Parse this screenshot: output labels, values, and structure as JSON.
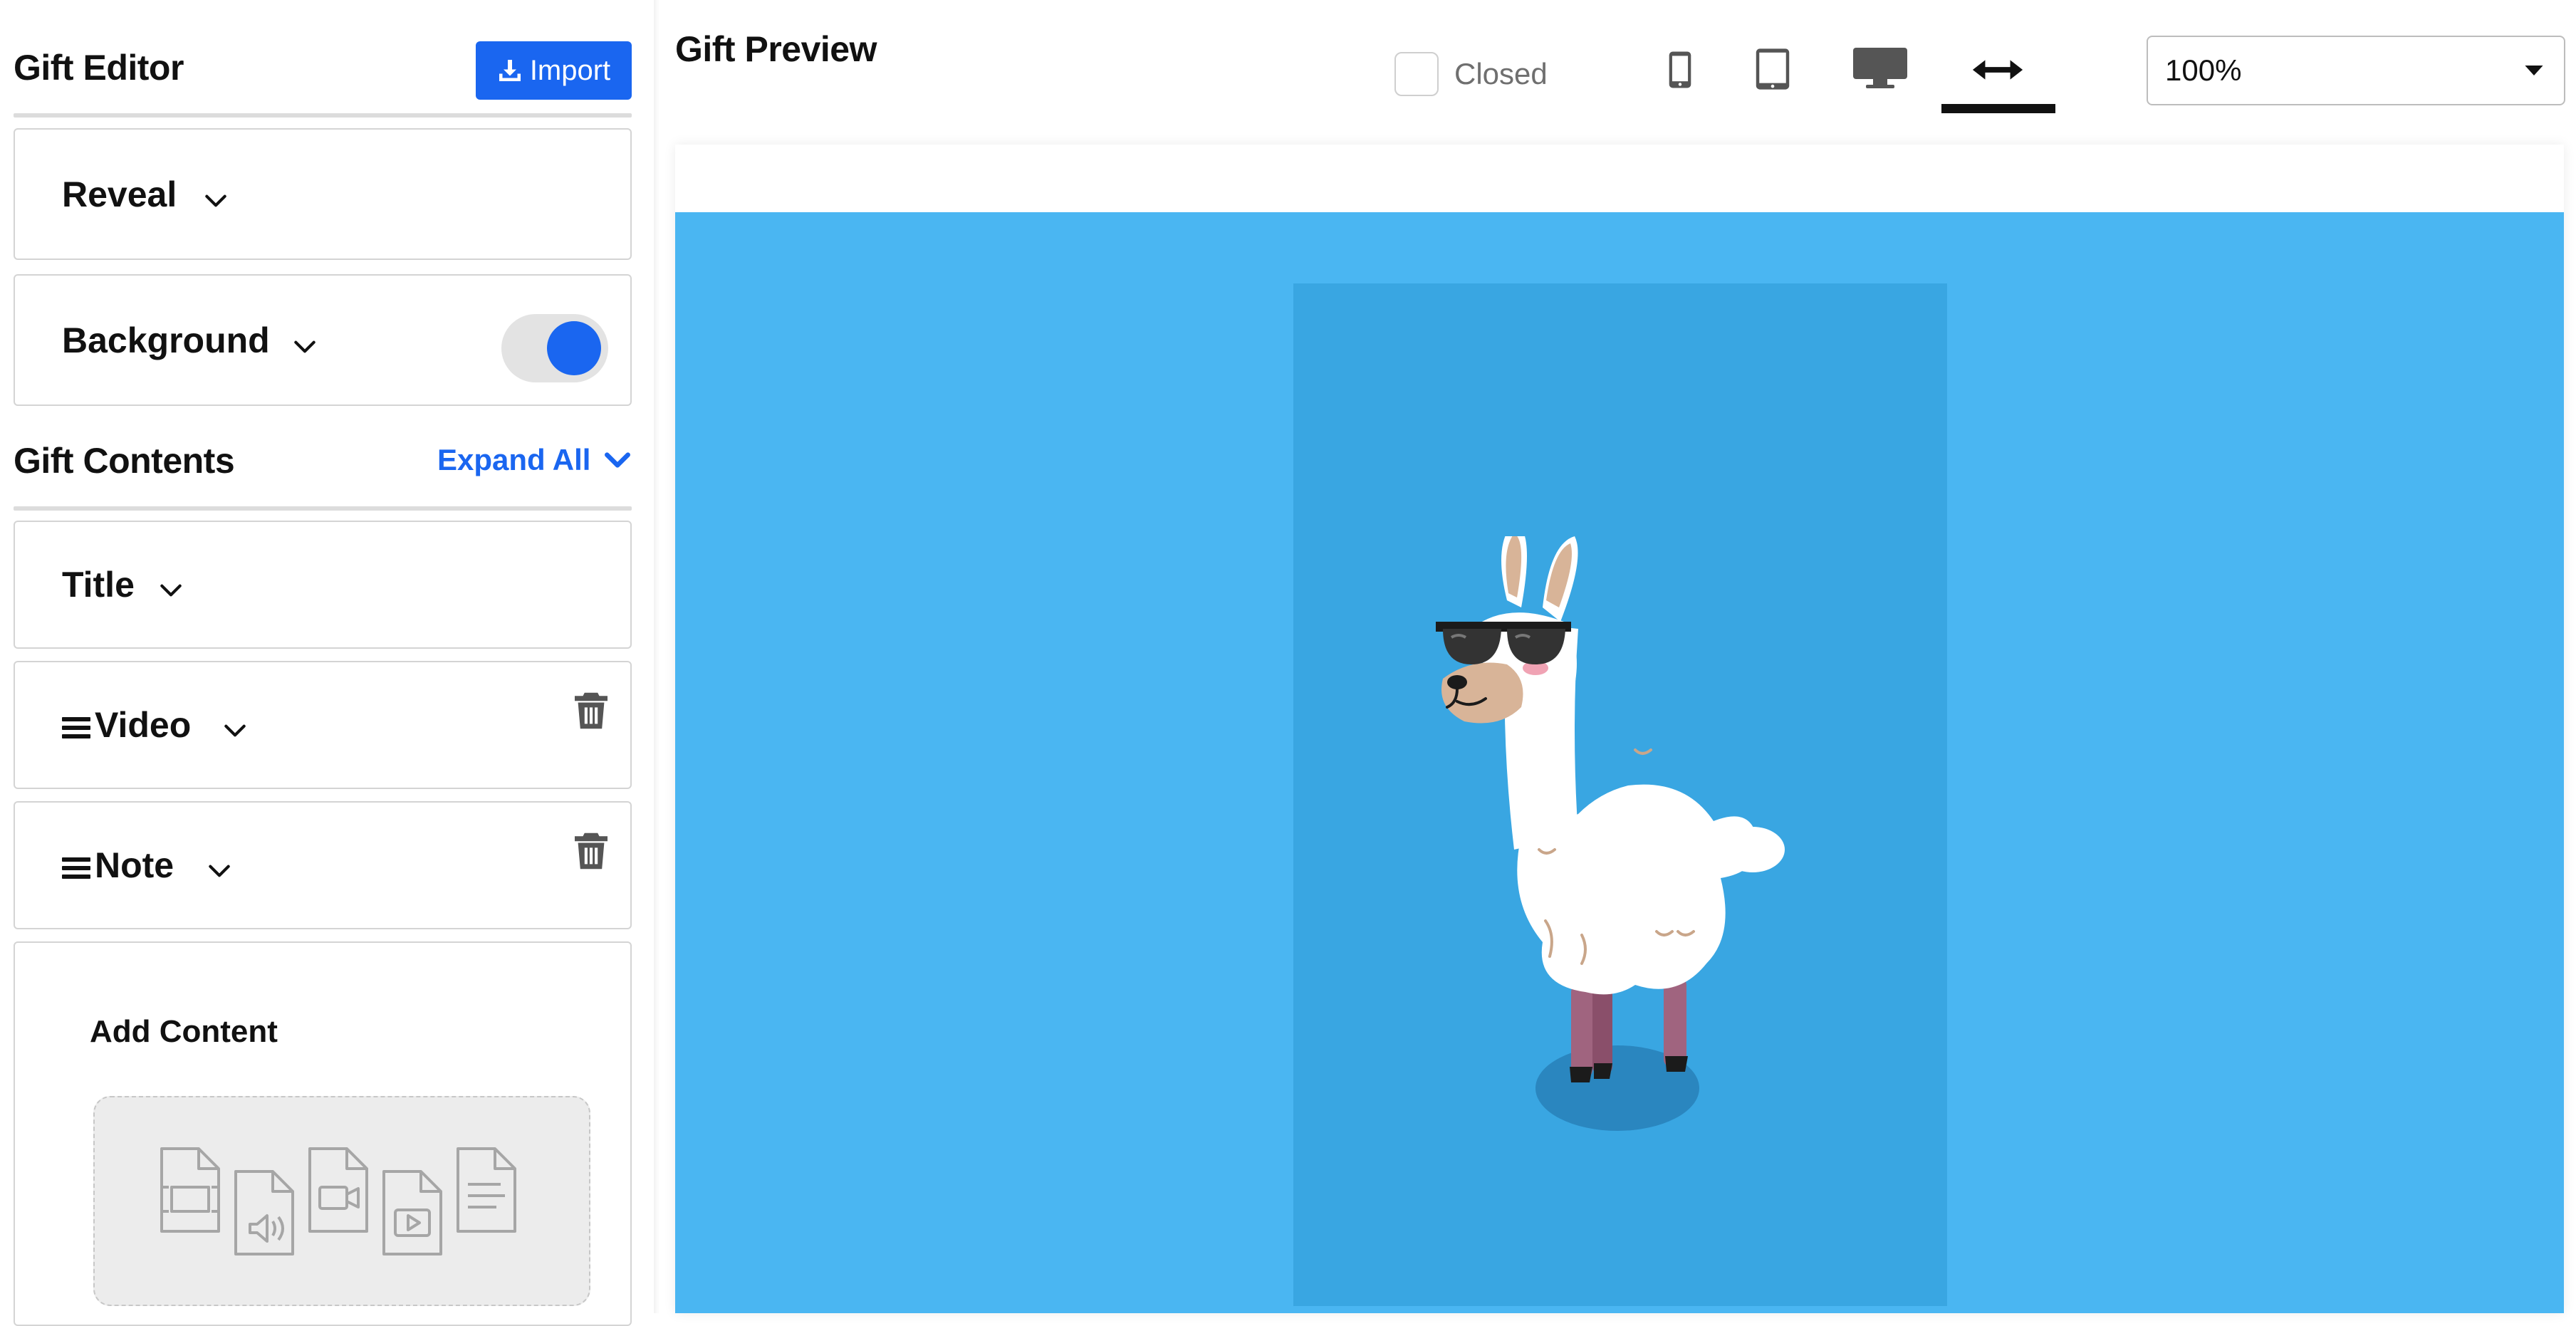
{
  "editor": {
    "title": "Gift Editor",
    "import_label": "Import",
    "settings": [
      {
        "label": "Reveal"
      },
      {
        "label": "Background",
        "toggle_on": true
      }
    ]
  },
  "contents": {
    "title": "Gift Contents",
    "expand_all_label": "Expand All",
    "items": [
      {
        "label": "Title",
        "draggable": false,
        "deletable": false
      },
      {
        "label": "Video",
        "draggable": true,
        "deletable": true
      },
      {
        "label": "Note",
        "draggable": true,
        "deletable": true
      }
    ],
    "add_content_title": "Add Content"
  },
  "preview": {
    "title": "Gift Preview",
    "closed_label": "Closed",
    "closed_checked": false,
    "devices": [
      "phone-icon",
      "tablet-icon",
      "desktop-icon",
      "full-width-icon"
    ],
    "active_device": "full-width-icon",
    "zoom_value": "100%"
  },
  "colors": {
    "accent": "#1a66f0",
    "preview_bg": "#4ab6f2",
    "preview_panel": "#39a6e2",
    "toggle_track": "#e3e3e3"
  }
}
